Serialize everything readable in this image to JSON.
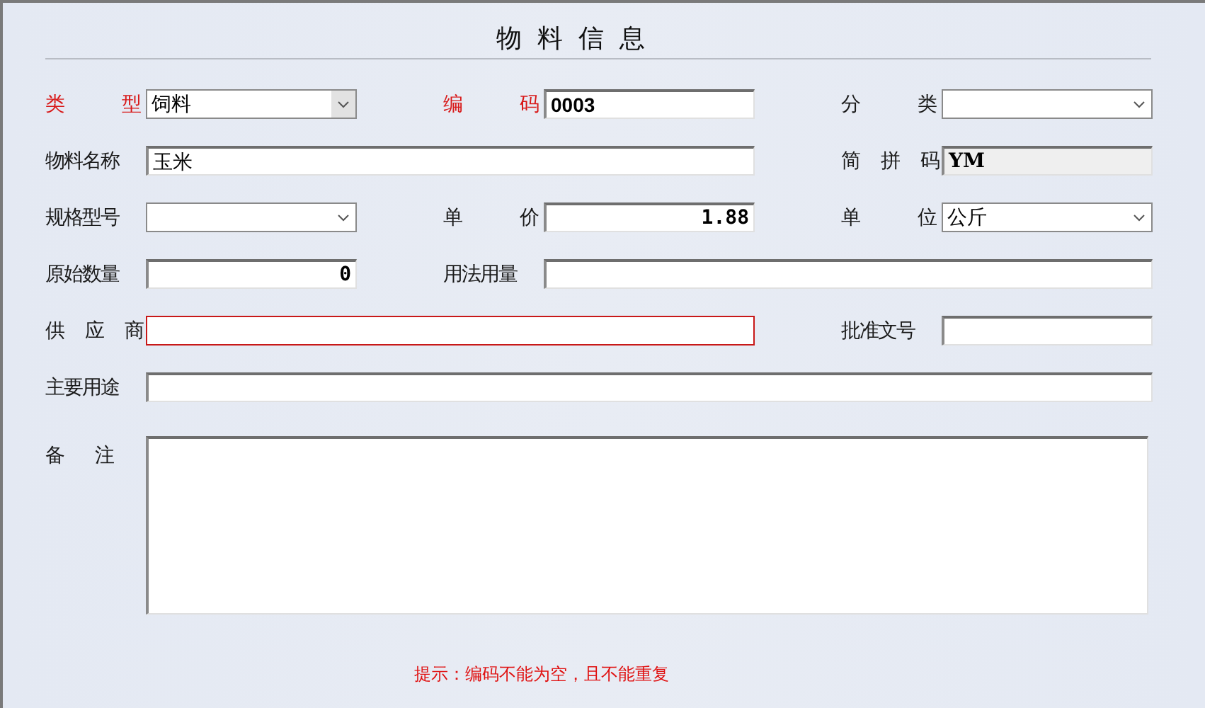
{
  "title": "物 料 信 息",
  "rows": [
    [
      {
        "label": "类 型",
        "required": true,
        "kind": "select",
        "value": "饲料",
        "disabled_caret": true
      },
      {
        "label": "编 码",
        "required": true,
        "kind": "text",
        "value": "0003",
        "bold": true
      },
      {
        "label": "分 类",
        "required": false,
        "kind": "select"
      }
    ],
    [
      {
        "label": "物料名称",
        "required": false,
        "kind": "text",
        "value": "玉米",
        "wide": true
      },
      {
        "label": "简 拼 码",
        "required": false,
        "kind": "readonly",
        "value": "YM"
      }
    ],
    [
      {
        "label": "规格型号",
        "required": false,
        "kind": "select"
      },
      {
        "label": "单 价",
        "required": false,
        "kind": "number",
        "value": "1.88"
      },
      {
        "label": "单 位",
        "required": false,
        "kind": "select",
        "value": "公斤"
      }
    ],
    [
      {
        "label": "原始数量",
        "required": false,
        "kind": "number",
        "value": "0"
      },
      {
        "label": "用法用量",
        "required": false,
        "kind": "text",
        "wide": true
      }
    ],
    [
      {
        "label": "供 应 商",
        "required": false,
        "kind": "text",
        "wide": true,
        "error": true
      },
      {
        "label": "批准文号",
        "required": false,
        "kind": "text"
      }
    ],
    [
      {
        "label": "主要用途",
        "required": false,
        "kind": "text",
        "wide": true
      }
    ]
  ],
  "remarks": {
    "label": "备 注"
  },
  "hint": "提示：编码不能为空，且不能重复"
}
